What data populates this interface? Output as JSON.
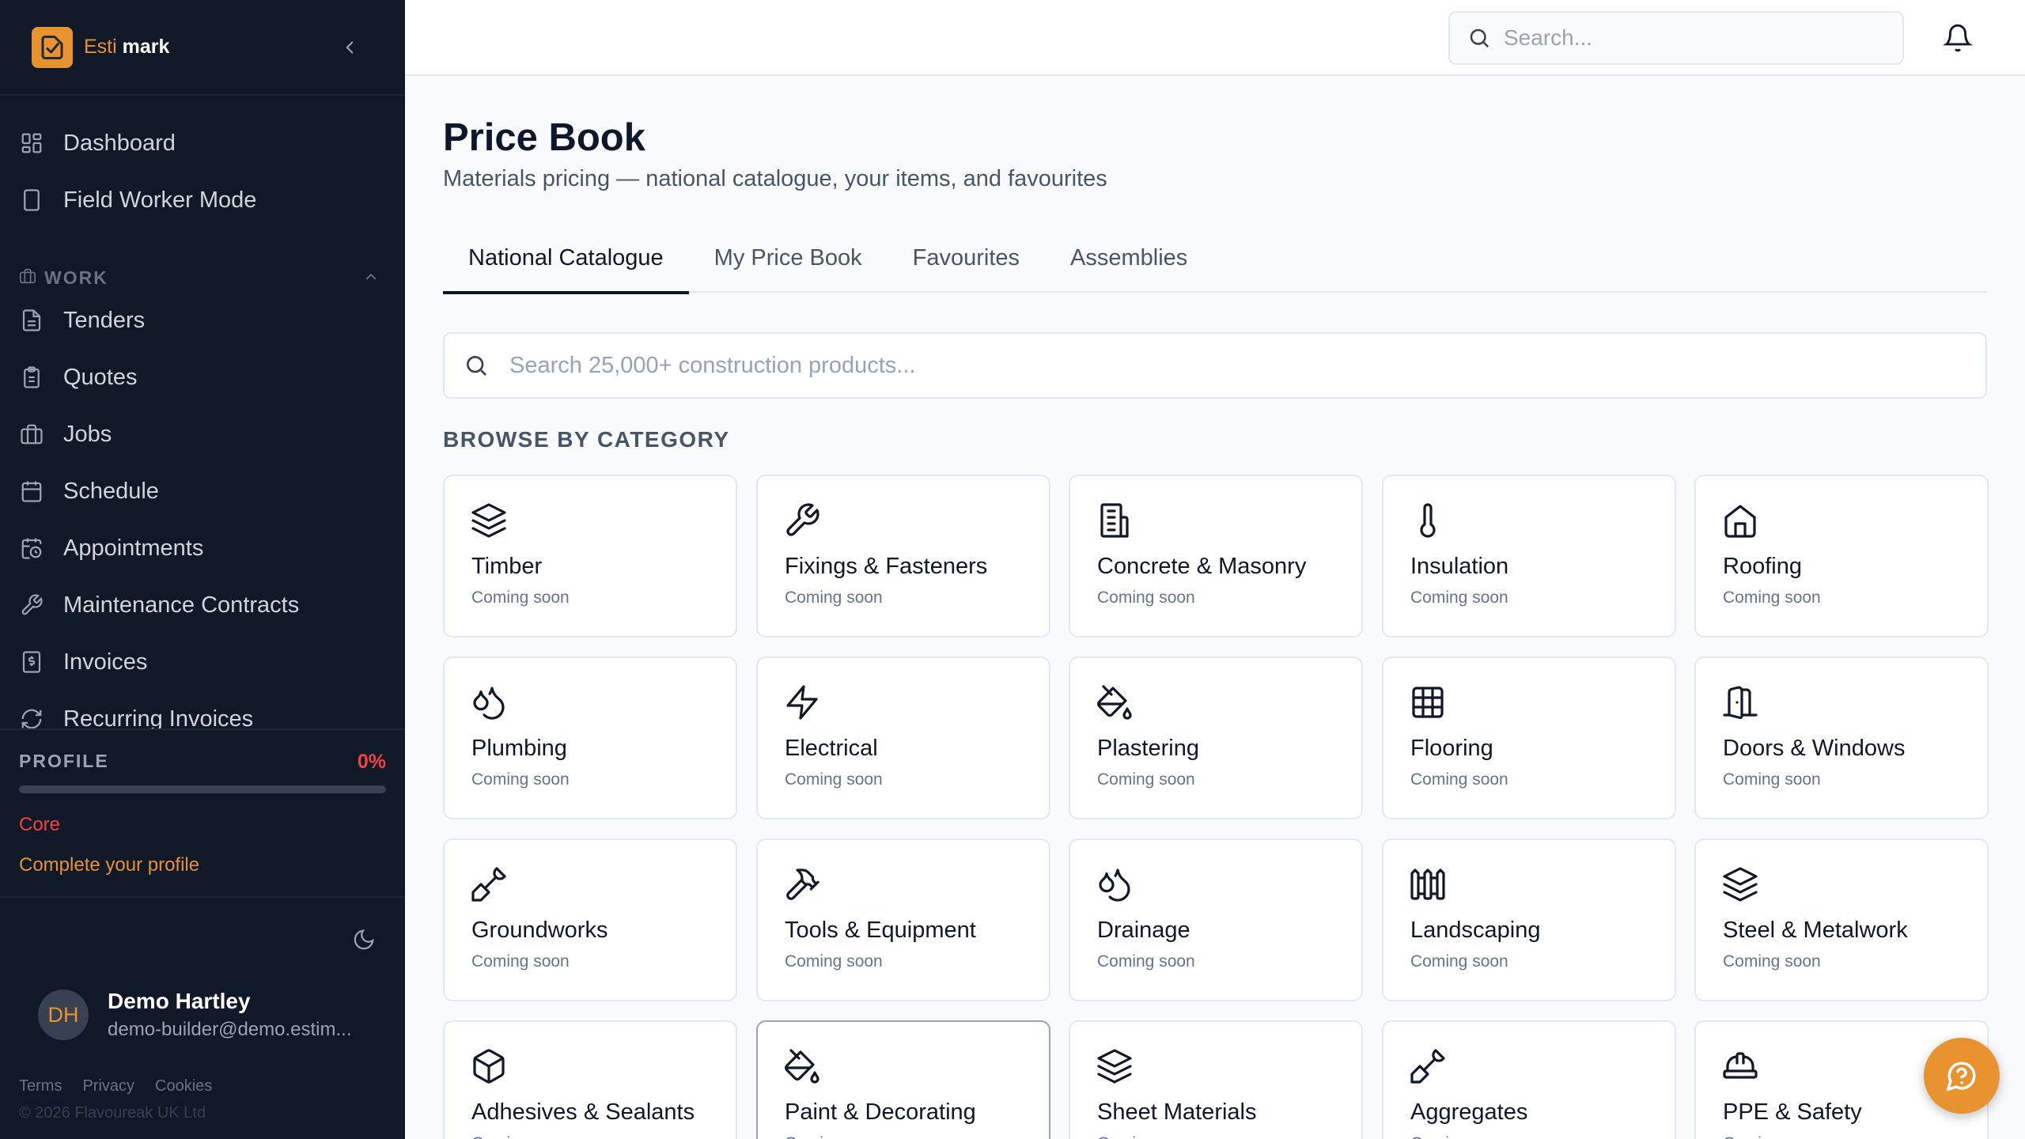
{
  "brand": {
    "name_prefix": "Esti",
    "name_suffix": "mark",
    "accent": "#e8932f"
  },
  "sidebar": {
    "primary": [
      {
        "label": "Dashboard",
        "icon": "dashboard-icon"
      },
      {
        "label": "Field Worker Mode",
        "icon": "phone-icon"
      }
    ],
    "section_work": {
      "label": "WORK",
      "items": [
        {
          "label": "Tenders",
          "icon": "document-icon"
        },
        {
          "label": "Quotes",
          "icon": "clipboard-icon"
        },
        {
          "label": "Jobs",
          "icon": "briefcase-icon"
        },
        {
          "label": "Schedule",
          "icon": "calendar-icon"
        },
        {
          "label": "Appointments",
          "icon": "calendar-clock-icon"
        },
        {
          "label": "Maintenance Contracts",
          "icon": "wrench-icon"
        },
        {
          "label": "Invoices",
          "icon": "invoice-icon"
        },
        {
          "label": "Recurring Invoices",
          "icon": "refresh-icon"
        }
      ]
    },
    "profile": {
      "heading": "PROFILE",
      "percent_label": "0%",
      "progress_fraction": 0,
      "tier": "Core",
      "cta": "Complete your profile"
    },
    "user": {
      "initials": "DH",
      "name": "Demo Hartley",
      "email": "demo-builder@demo.estim..."
    },
    "footer": {
      "links": [
        "Terms",
        "Privacy",
        "Cookies"
      ],
      "copyright": "© 2026 Flavoureak UK Ltd"
    }
  },
  "topbar": {
    "search_placeholder": "Search..."
  },
  "page": {
    "title": "Price Book",
    "subtitle": "Materials pricing — national catalogue, your items, and favourites",
    "tabs": [
      {
        "label": "National Catalogue",
        "active": true
      },
      {
        "label": "My Price Book",
        "active": false
      },
      {
        "label": "Favourites",
        "active": false
      },
      {
        "label": "Assemblies",
        "active": false
      }
    ],
    "product_search_placeholder": "Search 25,000+ construction products...",
    "browse_heading": "BROWSE BY CATEGORY",
    "categories": [
      {
        "name": "Timber",
        "status": "Coming soon",
        "icon": "layers-icon"
      },
      {
        "name": "Fixings & Fasteners",
        "status": "Coming soon",
        "icon": "wrench-icon"
      },
      {
        "name": "Concrete & Masonry",
        "status": "Coming soon",
        "icon": "building-icon"
      },
      {
        "name": "Insulation",
        "status": "Coming soon",
        "icon": "thermometer-icon"
      },
      {
        "name": "Roofing",
        "status": "Coming soon",
        "icon": "house-icon"
      },
      {
        "name": "Plumbing",
        "status": "Coming soon",
        "icon": "droplets-icon"
      },
      {
        "name": "Electrical",
        "status": "Coming soon",
        "icon": "lightning-icon"
      },
      {
        "name": "Plastering",
        "status": "Coming soon",
        "icon": "paint-bucket-icon"
      },
      {
        "name": "Flooring",
        "status": "Coming soon",
        "icon": "grid-icon"
      },
      {
        "name": "Doors & Windows",
        "status": "Coming soon",
        "icon": "door-icon"
      },
      {
        "name": "Groundworks",
        "status": "Coming soon",
        "icon": "shovel-icon"
      },
      {
        "name": "Tools & Equipment",
        "status": "Coming soon",
        "icon": "hammer-icon"
      },
      {
        "name": "Drainage",
        "status": "Coming soon",
        "icon": "droplets-icon"
      },
      {
        "name": "Landscaping",
        "status": "Coming soon",
        "icon": "fence-icon"
      },
      {
        "name": "Steel & Metalwork",
        "status": "Coming soon",
        "icon": "layers-icon"
      },
      {
        "name": "Adhesives & Sealants",
        "status": "Coming soon",
        "icon": "box-icon"
      },
      {
        "name": "Paint & Decorating",
        "status": "Coming soon",
        "icon": "paint-bucket-icon"
      },
      {
        "name": "Sheet Materials",
        "status": "Coming soon",
        "icon": "layers-icon"
      },
      {
        "name": "Aggregates",
        "status": "Coming soon",
        "icon": "shovel-icon"
      },
      {
        "name": "PPE & Safety",
        "status": "Coming soon",
        "icon": "hard-hat-icon"
      }
    ]
  }
}
